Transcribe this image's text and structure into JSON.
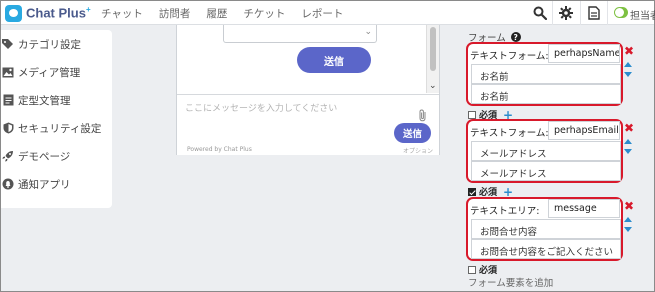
{
  "app": {
    "logo_text": "Chat Plus",
    "logo_sup": "+"
  },
  "nav": {
    "items": [
      "チャット",
      "訪問者",
      "履歴",
      "チケット",
      "レポート"
    ]
  },
  "header": {
    "icons": [
      "search-icon",
      "gear-icon",
      "document-icon"
    ],
    "toggle_on": true,
    "assignee_label": "担当者"
  },
  "sidebar": {
    "items": [
      {
        "label": "カテゴリ設定",
        "icon": "tag-icon"
      },
      {
        "label": "メディア管理",
        "icon": "image-icon"
      },
      {
        "label": "定型文管理",
        "icon": "template-icon"
      },
      {
        "label": "セキュリティ設定",
        "icon": "shield-icon"
      },
      {
        "label": "デモページ",
        "icon": "rocket-icon"
      },
      {
        "label": "通知アプリ",
        "icon": "bell-icon"
      }
    ]
  },
  "preview": {
    "send_label": "送信",
    "message_placeholder": "ここにメッセージを入力してください",
    "send_label_small": "送信",
    "powered_by": "Powered by Chat Plus",
    "option_text": "オプション"
  },
  "form": {
    "title": "フォーム",
    "help": "?",
    "fields": [
      {
        "type_label": "テキストフォーム:",
        "name": "perhapsName",
        "label_value": "お名前",
        "placeholder_value": "お名前",
        "required": false
      },
      {
        "type_label": "テキストフォーム:",
        "name": "perhapsEmail",
        "label_value": "メールアドレス",
        "placeholder_value": "メールアドレス",
        "required": true
      },
      {
        "type_label": "テキストエリア:",
        "name": "message",
        "label_value": "お問合せ内容",
        "placeholder_value": "お問合せ内容をご記入ください",
        "required": false
      }
    ],
    "required_label": "必須",
    "add_element_label": "フォーム要素を追加"
  },
  "colors": {
    "accent": "#5b66c9",
    "highlight_border": "#d8192b",
    "sort_arrow": "#2b8ccd",
    "toggle": "#7ec142"
  }
}
